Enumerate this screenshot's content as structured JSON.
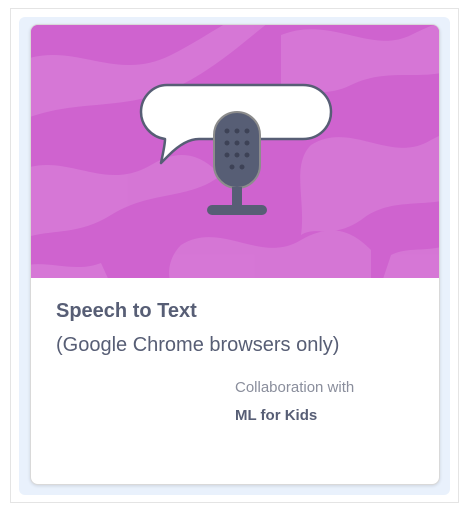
{
  "extension": {
    "title": "Speech to Text",
    "subtitle": "(Google Chrome browsers only)",
    "collaboration_label": "Collaboration with",
    "collaborator": "ML for Kids",
    "icon": "speech-bubble-microphone-icon"
  },
  "colors": {
    "banner": "#cf63cf",
    "banner_swirl": "#d77ad7",
    "text_primary": "#575e75",
    "text_secondary": "#8a8e9c",
    "selection_bg": "#e9f1fc"
  }
}
